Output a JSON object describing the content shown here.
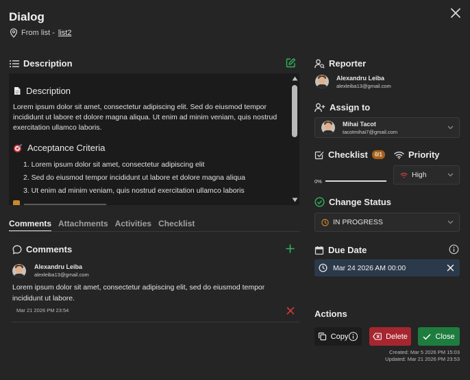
{
  "dialog": {
    "title": "Dialog",
    "from_prefix": "From list -",
    "from_link": "list2"
  },
  "description": {
    "section_title": "Description",
    "heading": "Description",
    "paragraph": "Lorem ipsum dolor sit amet, consectetur adipiscing elit. Sed do eiusmod tempor incididunt ut labore et dolore magna aliqua. Ut enim ad minim veniam, quis nostrud exercitation ullamco laboris.",
    "criteria_heading": "Acceptance Criteria",
    "criteria": [
      "1. Lorem ipsum dolor sit amet, consectetur adipiscing elit",
      "2. Sed do eiusmod tempor incididunt ut labore et dolore magna aliqua",
      "3. Ut enim ad minim veniam, quis nostrud exercitation ullamco laboris"
    ]
  },
  "tabs": [
    "Comments",
    "Attachments",
    "Activities",
    "Checklist"
  ],
  "comments": {
    "section_title": "Comments",
    "items": [
      {
        "name": "Alexandru Leiba",
        "email": "alexleiba13@gmail.com",
        "text": "Lorem ipsum dolor sit amet, consectetur adipiscing elit, sed do eiusmod tempor incididunt ut labore.",
        "date": "Mar 21 2026 PM 23:54"
      }
    ]
  },
  "reporter": {
    "section_title": "Reporter",
    "name": "Alexandru Leiba",
    "email": "alexleiba13@gmail.com"
  },
  "assign": {
    "section_title": "Assign to",
    "name": "Mihai Tacot",
    "email": "tacotmihai7@gmail.com"
  },
  "checklist": {
    "section_title": "Checklist",
    "badge": "0/1",
    "progress_label": "0%",
    "progress": 0
  },
  "priority": {
    "section_title": "Priority",
    "value": "High"
  },
  "status": {
    "section_title": "Change Status",
    "value": "IN PROGRESS"
  },
  "due_date": {
    "section_title": "Due Date",
    "value": "Mar 24 2026 AM 00:00"
  },
  "actions": {
    "section_title": "Actions",
    "copy_label": "Copy",
    "delete_label": "Delete",
    "close_label": "Close",
    "created": "Created:  Mar 5 2026 PM 15:03",
    "updated": "Updated:  Mar 21 2026 PM 23:53"
  },
  "colors": {
    "background": "#252525",
    "accent_green": "#2fb55a",
    "delete_red": "#a6262f",
    "close_green": "#1e7d3e",
    "status_orange": "#d88a2a",
    "priority_red": "#d0453d",
    "badge_orange": "#a4611d"
  }
}
